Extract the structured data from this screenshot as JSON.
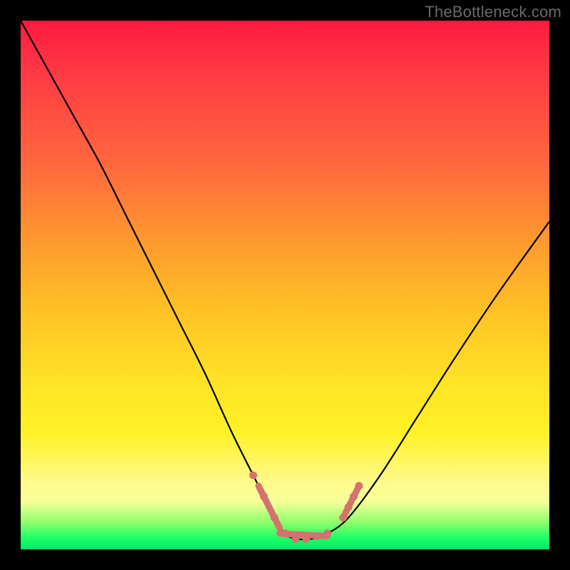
{
  "watermark": "TheBottleneck.com",
  "colors": {
    "frame": "#000000",
    "gradient_top": "#ff1a3e",
    "gradient_mid": "#ffe226",
    "gradient_bottom": "#00e865",
    "curve": "#000000",
    "marker": "#d5716f"
  },
  "chart_data": {
    "type": "line",
    "title": "",
    "xlabel": "",
    "ylabel": "",
    "xlim": [
      0,
      100
    ],
    "ylim": [
      0,
      100
    ],
    "series": [
      {
        "name": "bottleneck-curve",
        "x": [
          0,
          5,
          10,
          15,
          20,
          25,
          30,
          35,
          40,
          45,
          48,
          50,
          52,
          55,
          58,
          62,
          68,
          75,
          82,
          90,
          100
        ],
        "y": [
          100,
          91,
          82,
          73,
          63,
          53,
          43,
          33,
          22,
          12,
          6,
          3,
          2,
          2,
          3,
          6,
          14,
          25,
          36,
          48,
          62
        ]
      }
    ],
    "markers": [
      {
        "x": 44,
        "y": 14
      },
      {
        "x": 46,
        "y": 10
      },
      {
        "x": 48,
        "y": 6
      },
      {
        "x": 50,
        "y": 3
      },
      {
        "x": 52,
        "y": 2
      },
      {
        "x": 54,
        "y": 2
      },
      {
        "x": 56,
        "y": 2.5
      },
      {
        "x": 58,
        "y": 3
      },
      {
        "x": 61,
        "y": 6
      },
      {
        "x": 62,
        "y": 8
      },
      {
        "x": 63,
        "y": 10
      },
      {
        "x": 64,
        "y": 12
      }
    ],
    "marker_segments": [
      {
        "x1": 45,
        "y1": 12,
        "x2": 49,
        "y2": 4
      },
      {
        "x1": 49,
        "y1": 3,
        "x2": 58,
        "y2": 2.5
      },
      {
        "x1": 61,
        "y1": 6,
        "x2": 64,
        "y2": 12
      }
    ]
  }
}
